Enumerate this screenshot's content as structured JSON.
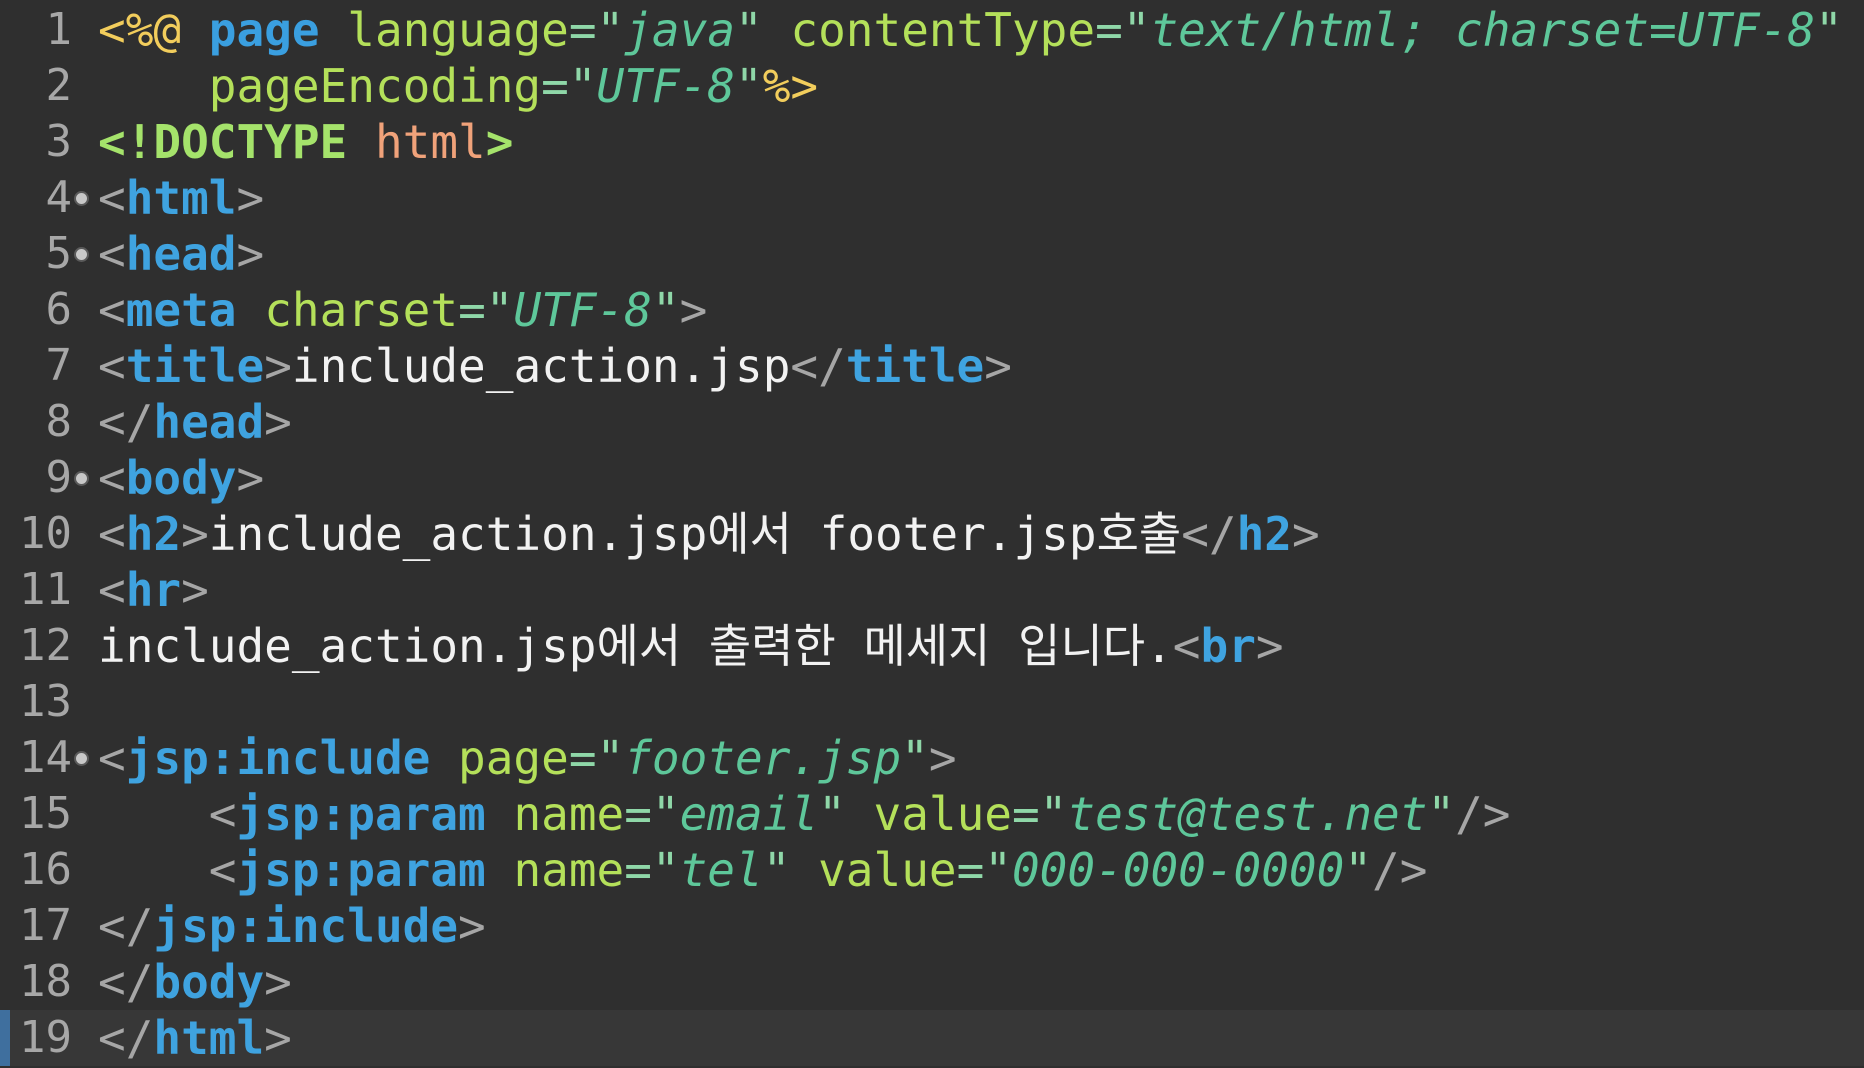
{
  "lines": [
    {
      "num": "1",
      "fold": false,
      "tokens": [
        {
          "t": "<%@",
          "c": "jsp-delim"
        },
        {
          "t": " ",
          "c": "sp"
        },
        {
          "t": "page",
          "c": "jsp-kw"
        },
        {
          "t": " ",
          "c": "sp"
        },
        {
          "t": "language",
          "c": "attr"
        },
        {
          "t": "=\"",
          "c": "str"
        },
        {
          "t": "java",
          "c": "str-i"
        },
        {
          "t": "\"",
          "c": "str"
        },
        {
          "t": " ",
          "c": "sp"
        },
        {
          "t": "contentType",
          "c": "attr"
        },
        {
          "t": "=\"",
          "c": "str"
        },
        {
          "t": "text/html; charset=UTF-8",
          "c": "str-i"
        },
        {
          "t": "\"",
          "c": "str"
        }
      ]
    },
    {
      "num": "2",
      "fold": false,
      "tokens": [
        {
          "t": "    ",
          "c": "sp"
        },
        {
          "t": "pageEncoding",
          "c": "attr"
        },
        {
          "t": "=\"",
          "c": "str"
        },
        {
          "t": "UTF-8",
          "c": "str-i"
        },
        {
          "t": "\"",
          "c": "str"
        },
        {
          "t": "%>",
          "c": "jsp-delim"
        }
      ]
    },
    {
      "num": "3",
      "fold": false,
      "tokens": [
        {
          "t": "<!DOCTYPE",
          "c": "doctype"
        },
        {
          "t": " ",
          "c": "sp"
        },
        {
          "t": "html",
          "c": "doctype-name"
        },
        {
          "t": ">",
          "c": "doctype"
        }
      ]
    },
    {
      "num": "4",
      "fold": true,
      "tokens": [
        {
          "t": "<",
          "c": "bracket"
        },
        {
          "t": "html",
          "c": "tag"
        },
        {
          "t": ">",
          "c": "bracket"
        }
      ]
    },
    {
      "num": "5",
      "fold": true,
      "tokens": [
        {
          "t": "<",
          "c": "bracket"
        },
        {
          "t": "head",
          "c": "tag"
        },
        {
          "t": ">",
          "c": "bracket"
        }
      ]
    },
    {
      "num": "6",
      "fold": false,
      "tokens": [
        {
          "t": "<",
          "c": "bracket"
        },
        {
          "t": "meta",
          "c": "tag"
        },
        {
          "t": " ",
          "c": "sp"
        },
        {
          "t": "charset",
          "c": "attr"
        },
        {
          "t": "=\"",
          "c": "str"
        },
        {
          "t": "UTF-8",
          "c": "str-i"
        },
        {
          "t": "\"",
          "c": "str"
        },
        {
          "t": ">",
          "c": "bracket"
        }
      ]
    },
    {
      "num": "7",
      "fold": false,
      "tokens": [
        {
          "t": "<",
          "c": "bracket"
        },
        {
          "t": "title",
          "c": "tag"
        },
        {
          "t": ">",
          "c": "bracket"
        },
        {
          "t": "include_action.jsp",
          "c": "text"
        },
        {
          "t": "</",
          "c": "bracket"
        },
        {
          "t": "title",
          "c": "tag"
        },
        {
          "t": ">",
          "c": "bracket"
        }
      ]
    },
    {
      "num": "8",
      "fold": false,
      "tokens": [
        {
          "t": "</",
          "c": "bracket"
        },
        {
          "t": "head",
          "c": "tag"
        },
        {
          "t": ">",
          "c": "bracket"
        }
      ]
    },
    {
      "num": "9",
      "fold": true,
      "tokens": [
        {
          "t": "<",
          "c": "bracket"
        },
        {
          "t": "body",
          "c": "tag"
        },
        {
          "t": ">",
          "c": "bracket"
        }
      ]
    },
    {
      "num": "10",
      "fold": false,
      "tokens": [
        {
          "t": "<",
          "c": "bracket"
        },
        {
          "t": "h2",
          "c": "tag"
        },
        {
          "t": ">",
          "c": "bracket"
        },
        {
          "t": "include_action.jsp에서 footer.jsp호출",
          "c": "text"
        },
        {
          "t": "</",
          "c": "bracket"
        },
        {
          "t": "h2",
          "c": "tag"
        },
        {
          "t": ">",
          "c": "bracket"
        }
      ]
    },
    {
      "num": "11",
      "fold": false,
      "tokens": [
        {
          "t": "<",
          "c": "bracket"
        },
        {
          "t": "hr",
          "c": "tag"
        },
        {
          "t": ">",
          "c": "bracket"
        }
      ]
    },
    {
      "num": "12",
      "fold": false,
      "tokens": [
        {
          "t": "include_action.jsp에서 출력한 메세지 입니다.",
          "c": "text"
        },
        {
          "t": "<",
          "c": "bracket"
        },
        {
          "t": "br",
          "c": "tag"
        },
        {
          "t": ">",
          "c": "bracket"
        }
      ]
    },
    {
      "num": "13",
      "fold": false,
      "tokens": []
    },
    {
      "num": "14",
      "fold": true,
      "tokens": [
        {
          "t": "<",
          "c": "bracket"
        },
        {
          "t": "jsp:include",
          "c": "tag"
        },
        {
          "t": " ",
          "c": "sp"
        },
        {
          "t": "page",
          "c": "attr"
        },
        {
          "t": "=\"",
          "c": "str"
        },
        {
          "t": "footer.jsp",
          "c": "str-i"
        },
        {
          "t": "\"",
          "c": "str"
        },
        {
          "t": ">",
          "c": "bracket"
        }
      ]
    },
    {
      "num": "15",
      "fold": false,
      "tokens": [
        {
          "t": "    ",
          "c": "sp"
        },
        {
          "t": "<",
          "c": "bracket"
        },
        {
          "t": "jsp:param",
          "c": "tag"
        },
        {
          "t": " ",
          "c": "sp"
        },
        {
          "t": "name",
          "c": "attr"
        },
        {
          "t": "=\"",
          "c": "str"
        },
        {
          "t": "email",
          "c": "str-i"
        },
        {
          "t": "\"",
          "c": "str"
        },
        {
          "t": " ",
          "c": "sp"
        },
        {
          "t": "value",
          "c": "attr"
        },
        {
          "t": "=\"",
          "c": "str"
        },
        {
          "t": "test@test.net",
          "c": "str-i"
        },
        {
          "t": "\"",
          "c": "str"
        },
        {
          "t": "/>",
          "c": "bracket"
        }
      ]
    },
    {
      "num": "16",
      "fold": false,
      "tokens": [
        {
          "t": "    ",
          "c": "sp"
        },
        {
          "t": "<",
          "c": "bracket"
        },
        {
          "t": "jsp:param",
          "c": "tag"
        },
        {
          "t": " ",
          "c": "sp"
        },
        {
          "t": "name",
          "c": "attr"
        },
        {
          "t": "=\"",
          "c": "str"
        },
        {
          "t": "tel",
          "c": "str-i"
        },
        {
          "t": "\"",
          "c": "str"
        },
        {
          "t": " ",
          "c": "sp"
        },
        {
          "t": "value",
          "c": "attr"
        },
        {
          "t": "=\"",
          "c": "str"
        },
        {
          "t": "000-000-0000",
          "c": "str-i"
        },
        {
          "t": "\"",
          "c": "str"
        },
        {
          "t": "/>",
          "c": "bracket"
        }
      ]
    },
    {
      "num": "17",
      "fold": false,
      "tokens": [
        {
          "t": "</",
          "c": "bracket"
        },
        {
          "t": "jsp:include",
          "c": "tag"
        },
        {
          "t": ">",
          "c": "bracket"
        }
      ]
    },
    {
      "num": "18",
      "fold": false,
      "tokens": [
        {
          "t": "</",
          "c": "bracket"
        },
        {
          "t": "body",
          "c": "tag"
        },
        {
          "t": ">",
          "c": "bracket"
        }
      ]
    },
    {
      "num": "19",
      "fold": false,
      "current": true,
      "tokens": [
        {
          "t": "</",
          "c": "bracket"
        },
        {
          "t": "html",
          "c": "tag"
        },
        {
          "t": ">",
          "c": "bracket"
        }
      ]
    }
  ]
}
